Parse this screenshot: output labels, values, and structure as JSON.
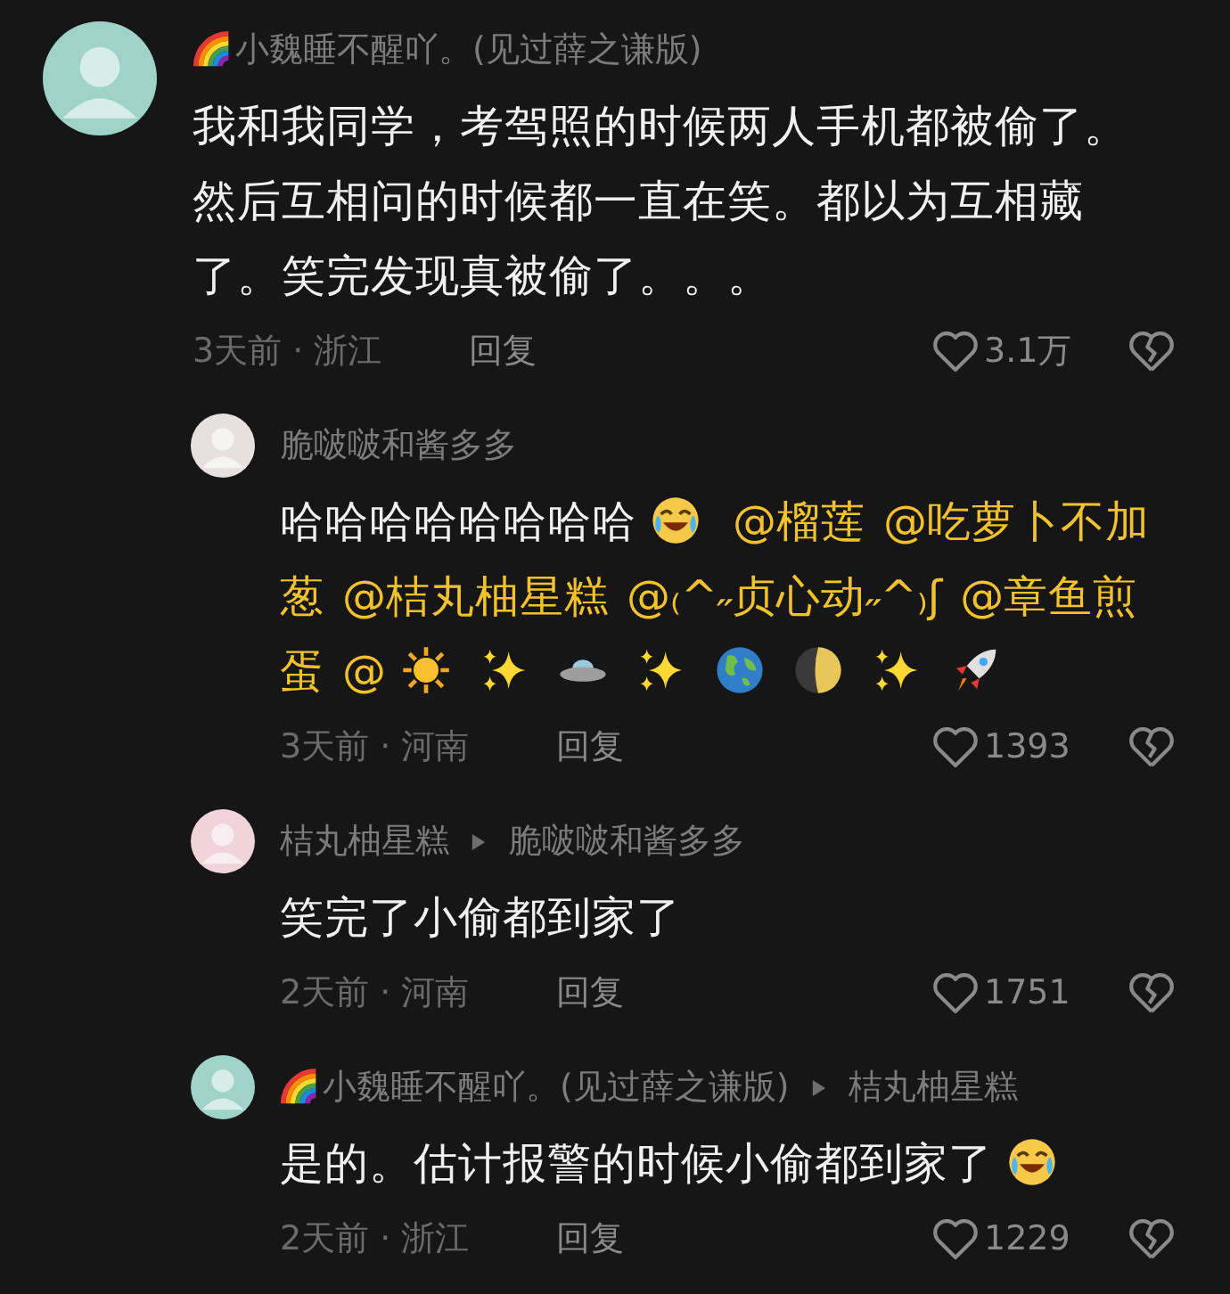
{
  "comments": [
    {
      "author": "小魏睡不醒吖。(见过薛之谦版)",
      "badge": true,
      "color": "#9fd3c7",
      "body_lines": [
        [
          {
            "kind": "text",
            "text": "我和我同学，考驾照的时候两人手机都被偷了。"
          }
        ],
        [
          {
            "kind": "text",
            "text": "然后互相问的时候都一直在笑。都以为互相藏"
          }
        ],
        [
          {
            "kind": "text",
            "text": "了。笑完发现真被偷了。。。"
          }
        ]
      ],
      "time": "3天前 · 浙江",
      "reply": "回复",
      "likes": "3.1万",
      "replies": [
        {
          "author": "脆啵啵和酱多多",
          "badge": false,
          "color": "#e8e0e0",
          "body_lines": [
            [
              {
                "kind": "text",
                "text": "哈哈哈哈哈哈哈哈"
              },
              {
                "kind": "tearsmile"
              },
              {
                "kind": "mention",
                "text": "@榴莲"
              },
              {
                "kind": "mention",
                "text": "@吃萝卜不加"
              }
            ],
            [
              {
                "kind": "mention",
                "text": "葱"
              },
              {
                "kind": "mention",
                "text": "@桔丸柚星糕"
              },
              {
                "kind": "mention",
                "text": "@₍^˶贞心动˶^₎ʃ"
              },
              {
                "kind": "mention",
                "text": "@章鱼煎"
              }
            ],
            [
              {
                "kind": "mention",
                "text": "蛋"
              },
              {
                "kind": "mention",
                "text": "@"
              },
              {
                "kind": "sun"
              },
              {
                "kind": "sparkles"
              },
              {
                "kind": "ufo"
              },
              {
                "kind": "sparkles"
              },
              {
                "kind": "earth"
              },
              {
                "kind": "moon"
              },
              {
                "kind": "sparkles"
              },
              {
                "kind": "rocket"
              }
            ]
          ],
          "time": "3天前 · 河南",
          "reply": "回复",
          "likes": "1393"
        },
        {
          "author": "桔丸柚星糕",
          "badge": false,
          "color": "#f1d3dc",
          "reply_to": "脆啵啵和酱多多",
          "body_lines": [
            [
              {
                "kind": "text",
                "text": "笑完了小偷都到家了"
              }
            ]
          ],
          "time": "2天前 · 河南",
          "reply": "回复",
          "likes": "1751"
        },
        {
          "author": "小魏睡不醒吖。(见过薛之谦版)",
          "badge": true,
          "color": "#9fd3c7",
          "reply_to": "桔丸柚星糕",
          "body_lines": [
            [
              {
                "kind": "text",
                "text": "是的。估计报警的时候小偷都到家了"
              },
              {
                "kind": "rofl"
              }
            ]
          ],
          "time": "2天前 · 浙江",
          "reply": "回复",
          "likes": "1229"
        }
      ]
    }
  ]
}
